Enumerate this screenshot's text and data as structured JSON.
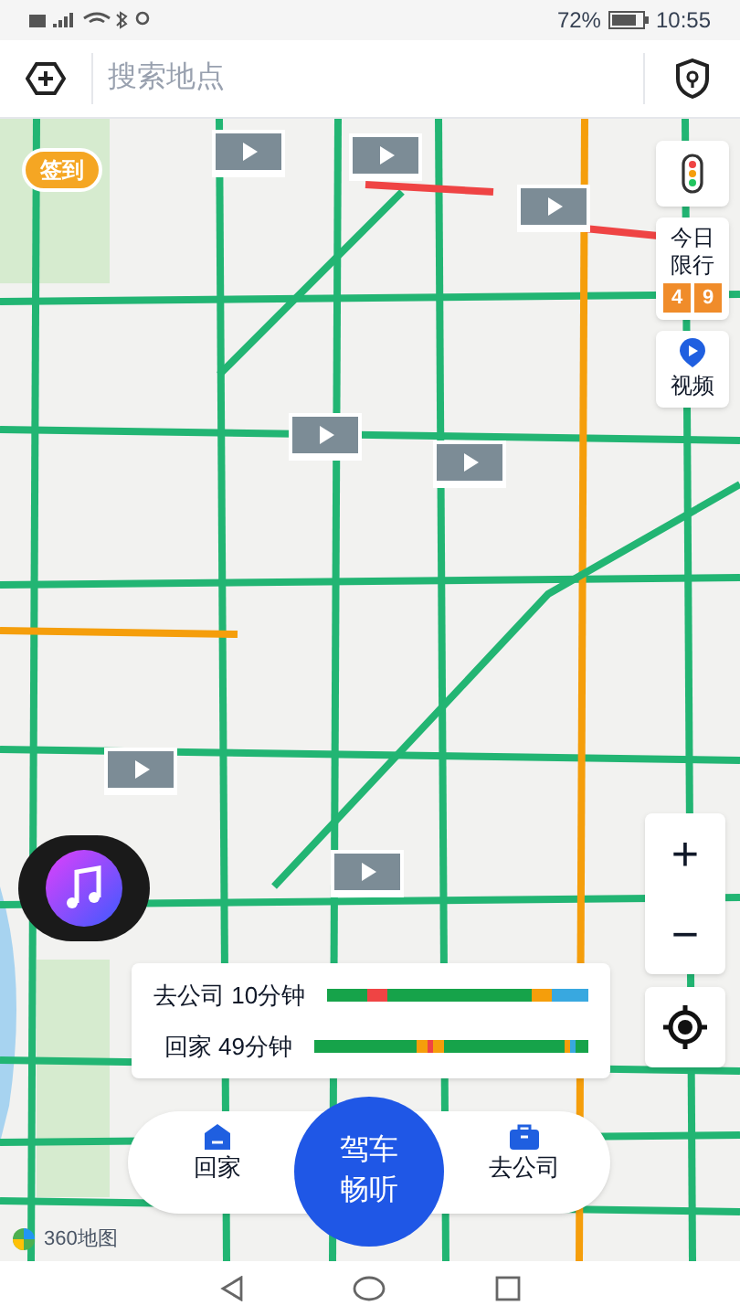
{
  "status_bar": {
    "battery": "72%",
    "time": "10:55"
  },
  "search": {
    "placeholder": "搜索地点"
  },
  "check_in": {
    "label": "签到"
  },
  "side_tools": [
    {
      "kind": "traffic"
    },
    {
      "kind": "restriction",
      "label": "今日限行",
      "plates": [
        "4",
        "9"
      ]
    },
    {
      "kind": "video",
      "label": "视频"
    }
  ],
  "zoom": {
    "in": "+",
    "out": "−"
  },
  "commute": [
    {
      "label": "去公司 10分钟"
    },
    {
      "label": "回家 49分钟"
    }
  ],
  "dock": {
    "home": "回家",
    "main": "驾车畅听",
    "work": "去公司"
  },
  "logo": "360地图"
}
